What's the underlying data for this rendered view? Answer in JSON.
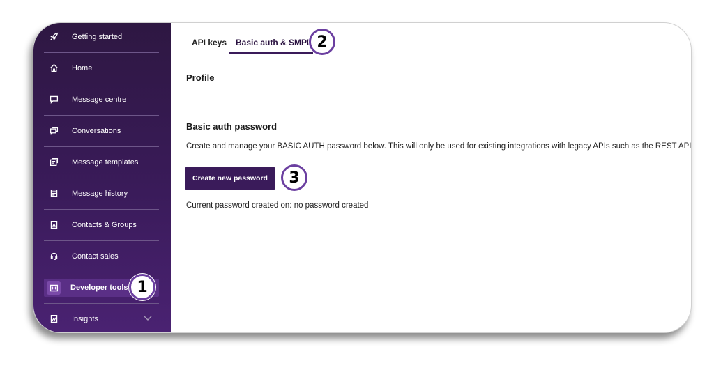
{
  "sidebar": {
    "items": [
      {
        "label": "Getting started",
        "icon": "rocket-icon"
      },
      {
        "label": "Home",
        "icon": "home-icon"
      },
      {
        "label": "Message centre",
        "icon": "message-icon"
      },
      {
        "label": "Conversations",
        "icon": "conversations-icon"
      },
      {
        "label": "Message templates",
        "icon": "templates-icon"
      },
      {
        "label": "Message history",
        "icon": "history-icon"
      },
      {
        "label": "Contacts & Groups",
        "icon": "contacts-icon"
      },
      {
        "label": "Contact sales",
        "icon": "headset-icon"
      },
      {
        "label": "Developer tools",
        "icon": "code-icon",
        "active": true
      },
      {
        "label": "Insights",
        "icon": "insights-icon"
      }
    ]
  },
  "tabs": [
    {
      "label": "API keys"
    },
    {
      "label": "Basic auth & SMPP",
      "active": true
    }
  ],
  "main": {
    "profile_heading": "Profile",
    "basic_auth_heading": "Basic auth password",
    "description": "Create and manage your BASIC AUTH password below. This will only be used for existing integrations with legacy APIs such as the REST API.",
    "create_button": "Create new password",
    "current_password": "Current password created on: no password created"
  },
  "badges": [
    "1",
    "2",
    "3"
  ],
  "colors": {
    "sidebar_bg": "#3a1b5a",
    "accent": "#6b3fa0",
    "button_bg": "#3a1b5a"
  }
}
